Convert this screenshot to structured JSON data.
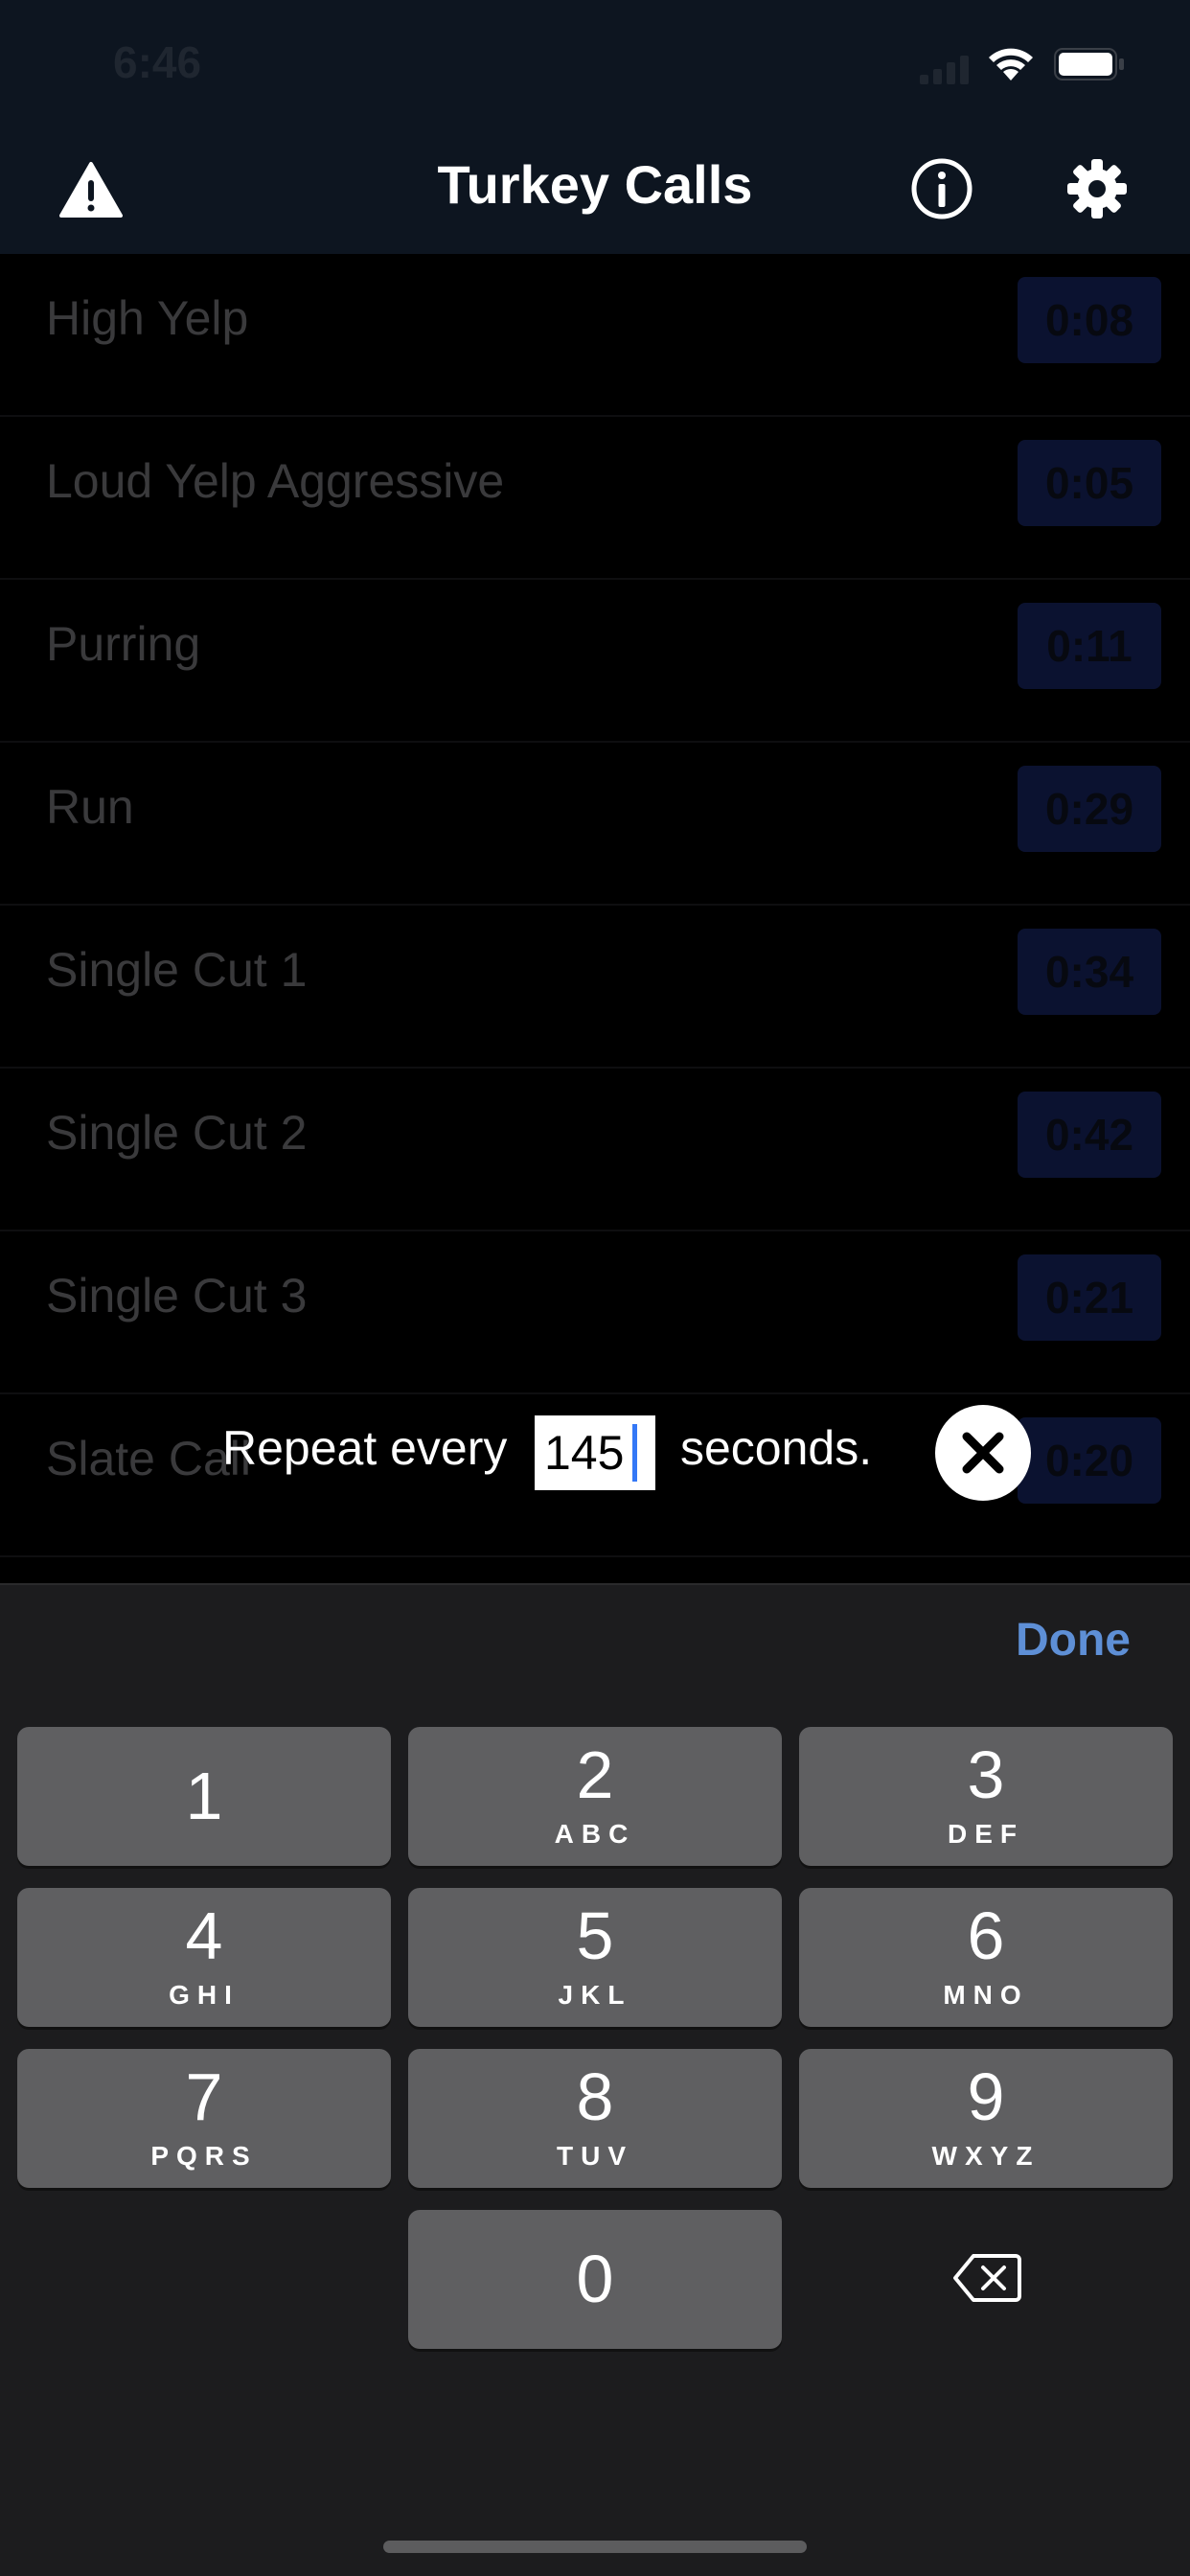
{
  "status_bar": {
    "time": "6:46"
  },
  "nav": {
    "title": "Turkey Calls",
    "icons": {
      "left": "warning-icon",
      "right_1": "info-icon",
      "right_2": "gear-icon"
    }
  },
  "calls": [
    {
      "name": "High Yelp",
      "duration": "0:08"
    },
    {
      "name": "Loud Yelp Aggressive",
      "duration": "0:05"
    },
    {
      "name": "Purring",
      "duration": "0:11"
    },
    {
      "name": "Run",
      "duration": "0:29"
    },
    {
      "name": "Single Cut 1",
      "duration": "0:34"
    },
    {
      "name": "Single Cut 2",
      "duration": "0:42"
    },
    {
      "name": "Single Cut 3",
      "duration": "0:21"
    },
    {
      "name": "Slate Call",
      "duration": "0:20"
    }
  ],
  "repeat": {
    "prefix": "Repeat every",
    "value": "145",
    "suffix": "seconds."
  },
  "keyboard": {
    "done_label": "Done",
    "keys": [
      {
        "digit": "1",
        "letters": ""
      },
      {
        "digit": "2",
        "letters": "ABC"
      },
      {
        "digit": "3",
        "letters": "DEF"
      },
      {
        "digit": "4",
        "letters": "GHI"
      },
      {
        "digit": "5",
        "letters": "JKL"
      },
      {
        "digit": "6",
        "letters": "MNO"
      },
      {
        "digit": "7",
        "letters": "PQRS"
      },
      {
        "digit": "8",
        "letters": "TUV"
      },
      {
        "digit": "9",
        "letters": "WXYZ"
      },
      {
        "digit": "0",
        "letters": ""
      }
    ]
  },
  "colors": {
    "bar_background": "#0d1520",
    "accent": "#5e8fd6",
    "caret": "#3478f6"
  }
}
